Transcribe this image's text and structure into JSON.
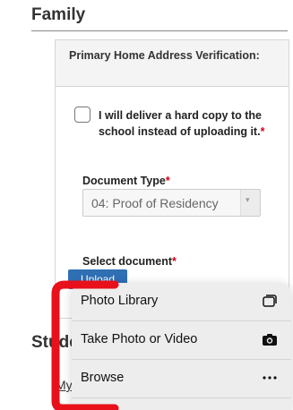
{
  "section": {
    "family_title": "Family",
    "students_title_partial": "Stude",
    "my_link_partial": "My"
  },
  "verification": {
    "header": "Primary Home Address Verification:",
    "checkbox_label": "I will deliver a hard copy to the school instead of uploading it.",
    "checkbox_required": "*",
    "checkbox_checked": false,
    "document_type_label": "Document Type",
    "document_type_required": "*",
    "document_type_value": "04: Proof of Residency",
    "select_document_label": "Select document",
    "select_document_required": "*",
    "upload_button_partial": "Upload"
  },
  "action_menu": {
    "items": [
      {
        "label": "Photo Library",
        "icon": "photo-library-icon"
      },
      {
        "label": "Take Photo or Video",
        "icon": "camera-icon"
      },
      {
        "label": "Browse",
        "icon": "more-icon"
      }
    ]
  },
  "colors": {
    "required": "#d0021b",
    "upload_button": "#2f6fb3",
    "annotation": "#e8101a"
  }
}
